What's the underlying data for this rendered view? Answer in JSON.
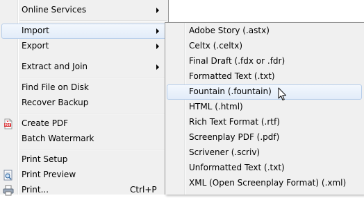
{
  "main_menu": {
    "items": [
      {
        "label": "Online Services",
        "has_submenu": true
      },
      {
        "label": "Import",
        "has_submenu": true,
        "highlighted": true
      },
      {
        "label": "Export",
        "has_submenu": true
      },
      {
        "label": "Extract and Join",
        "has_submenu": true
      },
      {
        "label": "Find File on Disk"
      },
      {
        "label": "Recover Backup"
      },
      {
        "label": "Create PDF",
        "icon": "pdf-icon"
      },
      {
        "label": "Batch Watermark"
      },
      {
        "label": "Print Setup"
      },
      {
        "label": "Print Preview",
        "icon": "print-preview-icon"
      },
      {
        "label": "Print...",
        "icon": "printer-icon",
        "shortcut": "Ctrl+P"
      }
    ]
  },
  "import_submenu": {
    "items": [
      {
        "label": "Adobe Story (.astx)"
      },
      {
        "label": "Celtx (.celtx)"
      },
      {
        "label": "Final Draft (.fdx or .fdr)"
      },
      {
        "label": "Formatted Text (.txt)"
      },
      {
        "label": "Fountain (.fountain)",
        "highlighted": true
      },
      {
        "label": "HTML (.html)"
      },
      {
        "label": "Rich Text Format (.rtf)"
      },
      {
        "label": "Screenplay PDF (.pdf)"
      },
      {
        "label": "Scrivener (.scriv)"
      },
      {
        "label": "Unformatted Text (.txt)"
      },
      {
        "label": "XML (Open Screenplay Format) (.xml)"
      }
    ]
  },
  "colors": {
    "menu_bg": "#f0f0f0",
    "highlight_border": "#b6cdea",
    "pdf_icon": "#d9262a"
  }
}
